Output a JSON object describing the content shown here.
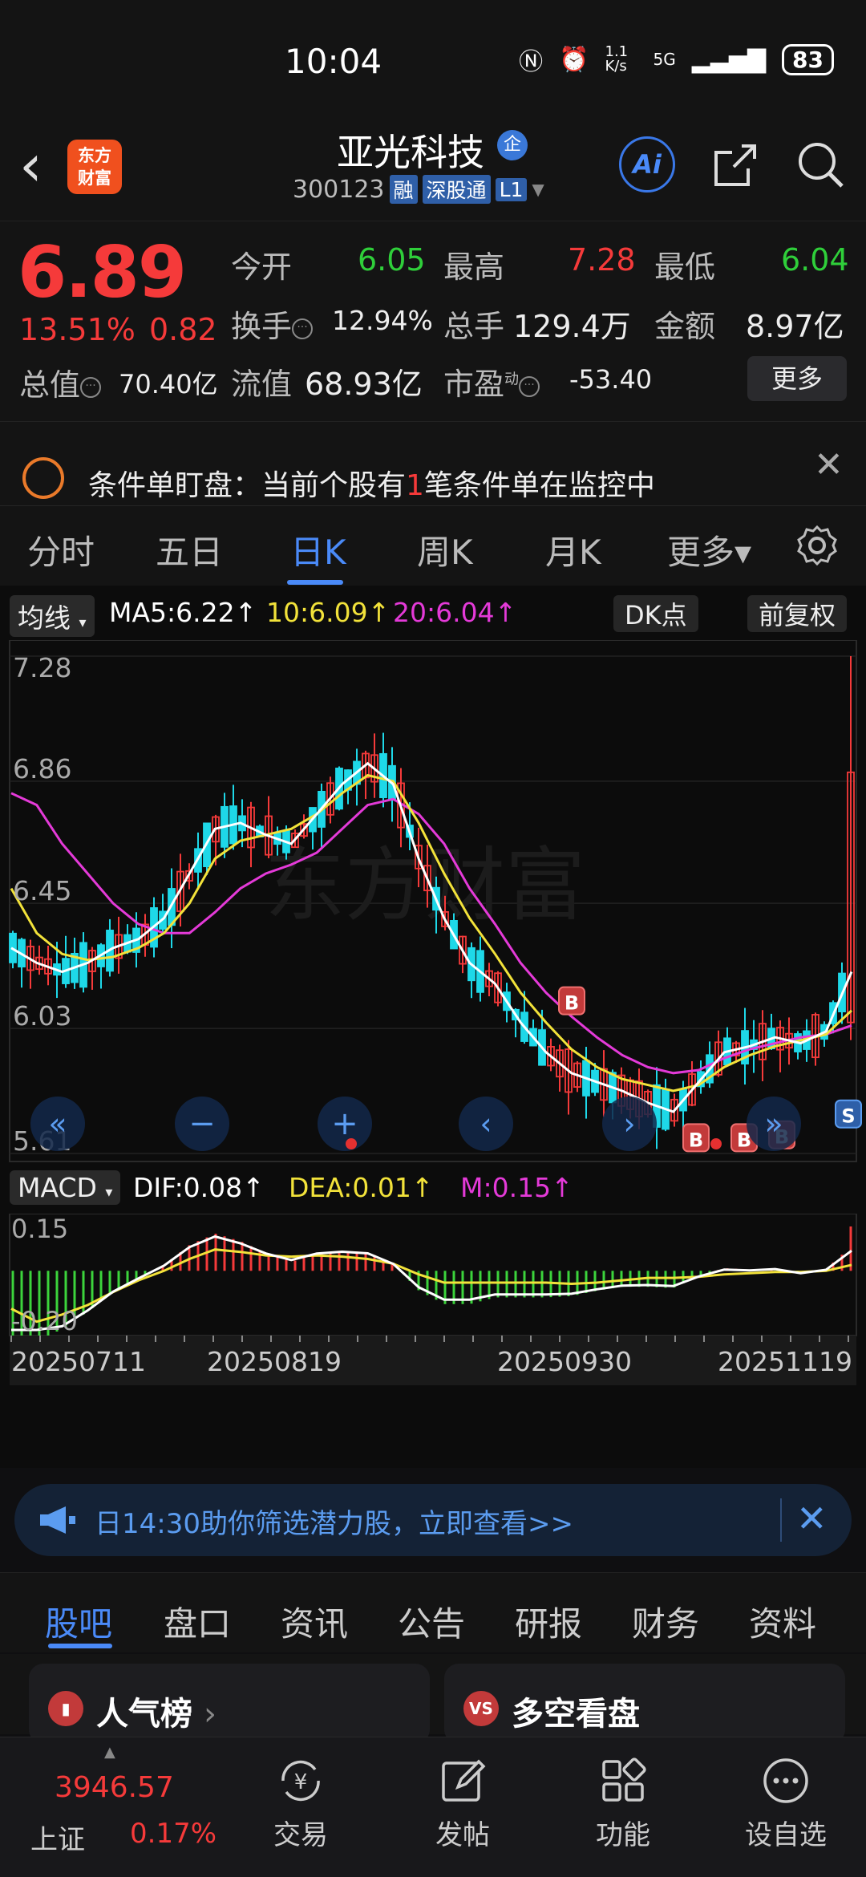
{
  "status_bar": {
    "time": "10:04",
    "net_speed": "1.1 K/s",
    "network": "5G",
    "battery": "83"
  },
  "header": {
    "logo_line1": "东方",
    "logo_line2": "财富",
    "stock_name": "亚光科技",
    "qi_badge": "企",
    "stock_code": "300123",
    "tags": [
      "融",
      "深股通",
      "L1"
    ],
    "ai_label": "Ai"
  },
  "quote": {
    "price": "6.89",
    "change_pct": "13.51%",
    "change": "0.82",
    "open_label": "今开",
    "open": "6.05",
    "high_label": "最高",
    "high": "7.28",
    "low_label": "最低",
    "low": "6.04",
    "turnover_label": "换手",
    "turnover": "12.94%",
    "volume_label": "总手",
    "volume": "129.4万",
    "amount_label": "金额",
    "amount": "8.97亿",
    "mktcap_label": "总值",
    "mktcap": "70.40亿",
    "float_label": "流值",
    "float_cap": "68.93亿",
    "pe_label": "市盈",
    "pe_sup": "动",
    "pe": "-53.40",
    "more_label": "更多"
  },
  "condition_banner": {
    "text_prefix": "条件单盯盘：当前个股有",
    "count": "1",
    "text_suffix": "笔条件单在监控中"
  },
  "period_tabs": [
    "分时",
    "五日",
    "日K",
    "周K",
    "月K",
    "更多▾"
  ],
  "active_period": "日K",
  "ma_bar": {
    "selector": "均线",
    "ma5": "MA5:6.22↑",
    "ma10": "10:6.09↑",
    "ma20": "20:6.04↑",
    "dk_label": "DK点",
    "adjust_label": "前复权"
  },
  "macd_bar": {
    "selector": "MACD",
    "dif": "DIF:0.08↑",
    "dea": "DEA:0.01↑",
    "m": "M:0.15↑"
  },
  "colors": {
    "up": "#f53a3a",
    "down": "#1ed8e8",
    "ma5": "#ffffff",
    "ma10": "#f2e23a",
    "ma20": "#e43ad8",
    "accent": "#4a8af8"
  },
  "chart_data": {
    "type": "candlestick",
    "y_ticks": [
      "7.28",
      "6.86",
      "6.45",
      "6.03",
      "5.61"
    ],
    "ylim": [
      5.61,
      7.28
    ],
    "x_ticks": [
      "20250711",
      "20250819",
      "20250930",
      "20251119"
    ],
    "watermark": "东方财富",
    "markers": [
      "B",
      "B",
      "B",
      "B",
      "S"
    ],
    "ma5": [
      6.3,
      6.25,
      6.22,
      6.25,
      6.3,
      6.33,
      6.4,
      6.55,
      6.7,
      6.72,
      6.68,
      6.65,
      6.75,
      6.85,
      6.92,
      6.85,
      6.6,
      6.4,
      6.25,
      6.18,
      6.05,
      5.95,
      5.88,
      5.85,
      5.82,
      5.78,
      5.75,
      5.85,
      5.95,
      5.97,
      6.0,
      5.98,
      6.02,
      6.22
    ],
    "ma10": [
      6.5,
      6.35,
      6.28,
      6.26,
      6.27,
      6.3,
      6.35,
      6.45,
      6.6,
      6.66,
      6.68,
      6.7,
      6.75,
      6.82,
      6.88,
      6.86,
      6.72,
      6.55,
      6.4,
      6.28,
      6.15,
      6.05,
      5.96,
      5.9,
      5.86,
      5.84,
      5.82,
      5.84,
      5.9,
      5.94,
      5.97,
      5.99,
      6.01,
      6.09
    ],
    "ma20": [
      6.82,
      6.78,
      6.65,
      6.55,
      6.45,
      6.38,
      6.35,
      6.35,
      6.42,
      6.5,
      6.55,
      6.58,
      6.62,
      6.7,
      6.78,
      6.8,
      6.75,
      6.65,
      6.5,
      6.38,
      6.25,
      6.15,
      6.07,
      6.0,
      5.94,
      5.9,
      5.88,
      5.89,
      5.93,
      5.96,
      5.98,
      6.0,
      6.01,
      6.04
    ],
    "macd_ticks": [
      "0.15",
      "-0.20"
    ],
    "macd_ylim": [
      -0.2,
      0.15
    ]
  },
  "ad_banner": {
    "text": "日14:30助你筛选潜力股，立即查看>>"
  },
  "section_tabs": [
    "股吧",
    "盘口",
    "资讯",
    "公告",
    "研报",
    "财务",
    "资料"
  ],
  "cards": [
    {
      "icon": "人气",
      "title": "人气榜"
    },
    {
      "icon": "VS",
      "title": "多空看盘"
    }
  ],
  "bottom_nav": {
    "index_value": "3946.57",
    "index_name": "上证",
    "index_pct": "0.17%",
    "items": [
      "交易",
      "发帖",
      "功能",
      "设自选"
    ]
  }
}
